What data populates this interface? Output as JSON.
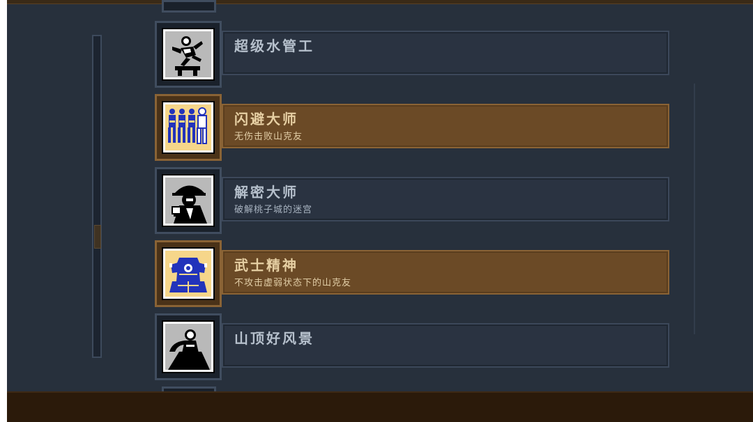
{
  "achievements": [
    {
      "title": "超级水管工",
      "description": "",
      "unlocked": false,
      "icon": "plumber-jump-icon"
    },
    {
      "title": "闪避大师",
      "description": "无伤击败山克友",
      "unlocked": true,
      "icon": "dodge-afterimage-icon"
    },
    {
      "title": "解密大师",
      "description": "破解桃子城的迷宫",
      "unlocked": false,
      "icon": "detective-icon"
    },
    {
      "title": "武士精神",
      "description": "不攻击虚弱状态下的山克友",
      "unlocked": true,
      "icon": "samurai-armor-icon"
    },
    {
      "title": "山顶好风景",
      "description": "",
      "unlocked": false,
      "icon": "mountain-top-icon"
    }
  ],
  "scroll": {
    "position_fraction": 0.64
  },
  "colors": {
    "background": "#27303c",
    "locked_bar": "#2a3341",
    "unlocked_bar": "#6b4a26",
    "unlocked_icon_bg": "#f6d68a",
    "locked_icon_bg": "#b9b9b9",
    "bottom_bar": "#2b1a0a"
  }
}
